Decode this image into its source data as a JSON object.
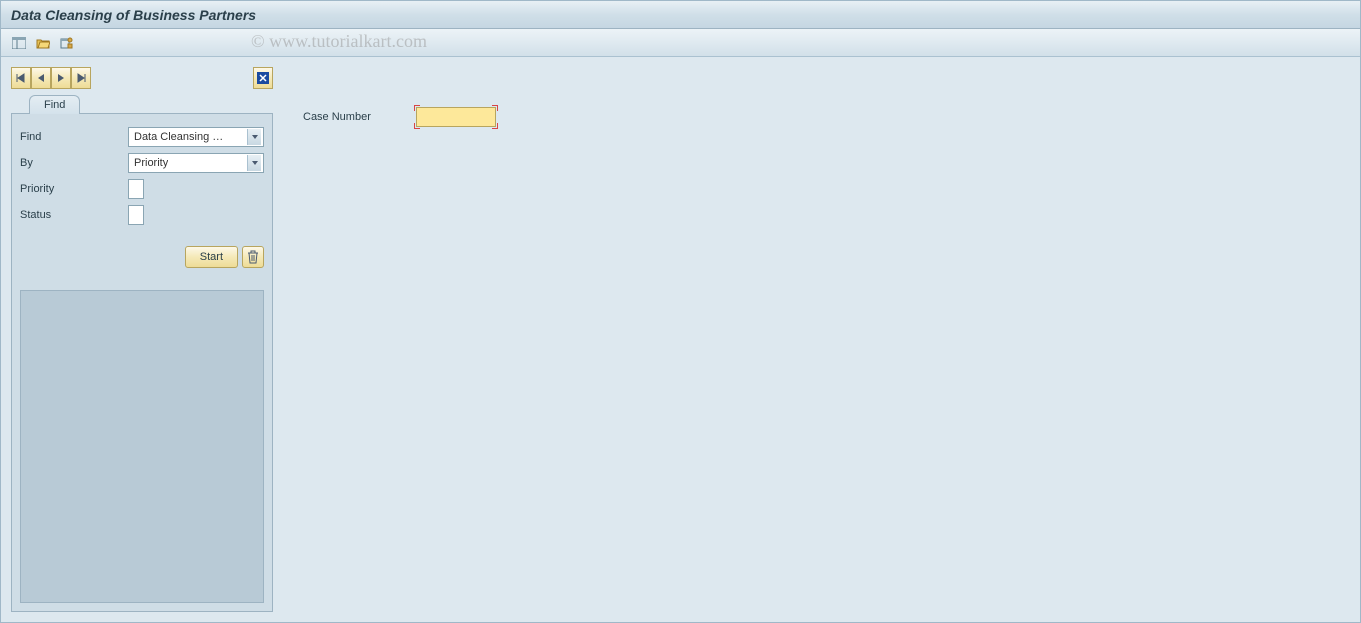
{
  "app": {
    "title": "Data Cleansing of Business Partners"
  },
  "watermark": "© www.tutorialkart.com",
  "toolbar_icons": {
    "layout": "layout-icon",
    "folder": "folder-icon",
    "personalize": "personalize-icon"
  },
  "sidebar": {
    "tab_label": "Find",
    "fields": {
      "find_label": "Find",
      "find_value": "Data Cleansing C…",
      "by_label": "By",
      "by_value": "Priority",
      "priority_label": "Priority",
      "priority_value": "",
      "status_label": "Status",
      "status_value": ""
    },
    "start_label": "Start"
  },
  "main": {
    "case_number_label": "Case Number",
    "case_number_value": ""
  }
}
